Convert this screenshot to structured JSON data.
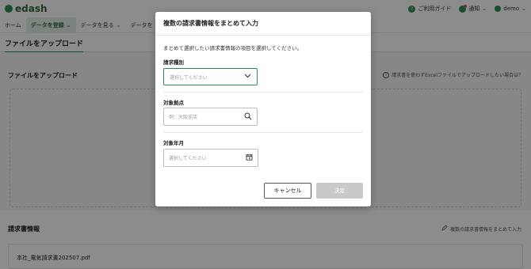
{
  "app": {
    "logo_text": "edash"
  },
  "topbar": {
    "guide_label": "ご利用ガイド",
    "notice_label": "通知",
    "user_label": "demo"
  },
  "navbar": {
    "items": [
      {
        "label": "ホーム"
      },
      {
        "label": "データを登録"
      },
      {
        "label": "データを見る"
      },
      {
        "label": "データを"
      }
    ]
  },
  "page": {
    "subheader_title": "ファイルをアップロード",
    "upload_section_title": "ファイルをアップロード",
    "upload_help_text": "請求書を使わずExcelファイルでアップロードしたい場合は？",
    "invoice_section_title": "請求書情報",
    "bulk_input_link": "複数の請求書情報をまとめて入力",
    "file_name": "本社_電気請求書202507.pdf"
  },
  "modal": {
    "title": "複数の請求書情報をまとめて入力",
    "description": "まとめて選択したい請求書情報の項目を選択してください。",
    "invoice_type": {
      "label": "請求種別",
      "placeholder": "選択してください"
    },
    "location": {
      "label": "対象拠点",
      "placeholder": "例：大阪支店"
    },
    "period": {
      "label": "対象年月",
      "placeholder": "選択してください"
    },
    "cancel_label": "キャンセル",
    "confirm_label": "決定"
  }
}
